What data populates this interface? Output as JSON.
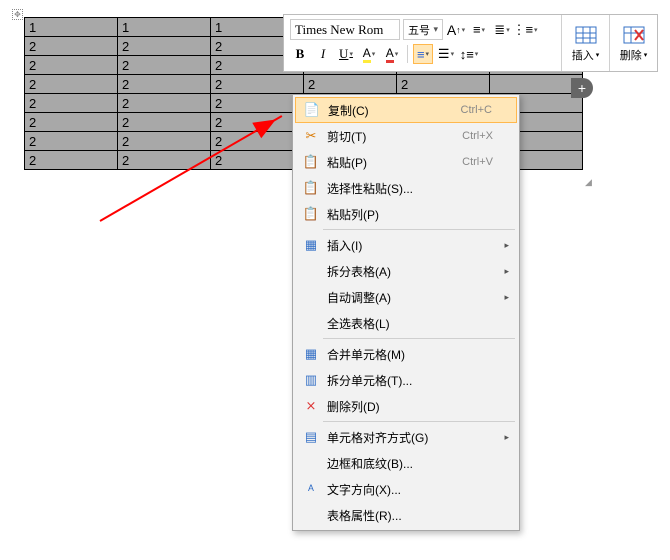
{
  "toolbar": {
    "font_name": "Times New Rom",
    "font_size": "五号",
    "btn_bold": "B",
    "btn_italic": "I",
    "btn_underline": "U",
    "side_insert": "插入",
    "side_delete": "删除"
  },
  "table": {
    "rows": [
      [
        "1",
        "1",
        "1",
        "",
        "",
        ""
      ],
      [
        "2",
        "2",
        "2",
        "",
        "",
        ""
      ],
      [
        "2",
        "2",
        "2",
        "",
        "",
        ""
      ],
      [
        "2",
        "2",
        "2",
        "2",
        "2",
        ""
      ],
      [
        "2",
        "2",
        "2",
        "",
        "",
        ""
      ],
      [
        "2",
        "2",
        "2",
        "",
        "",
        ""
      ],
      [
        "2",
        "2",
        "2",
        "",
        "",
        ""
      ],
      [
        "2",
        "2",
        "2",
        "",
        "",
        ""
      ]
    ]
  },
  "ctx": {
    "copy": "复制(C)",
    "copy_sc": "Ctrl+C",
    "cut": "剪切(T)",
    "cut_sc": "Ctrl+X",
    "paste": "粘贴(P)",
    "paste_sc": "Ctrl+V",
    "paste_special": "选择性粘贴(S)...",
    "paste_col": "粘贴列(P)",
    "insert": "插入(I)",
    "split_table": "拆分表格(A)",
    "auto_fit": "自动调整(A)",
    "select_table": "全选表格(L)",
    "merge": "合并单元格(M)",
    "split_cell": "拆分单元格(T)...",
    "del_col": "删除列(D)",
    "align": "单元格对齐方式(G)",
    "borders": "边框和底纹(B)...",
    "text_dir": "文字方向(X)...",
    "props": "表格属性(R)..."
  }
}
